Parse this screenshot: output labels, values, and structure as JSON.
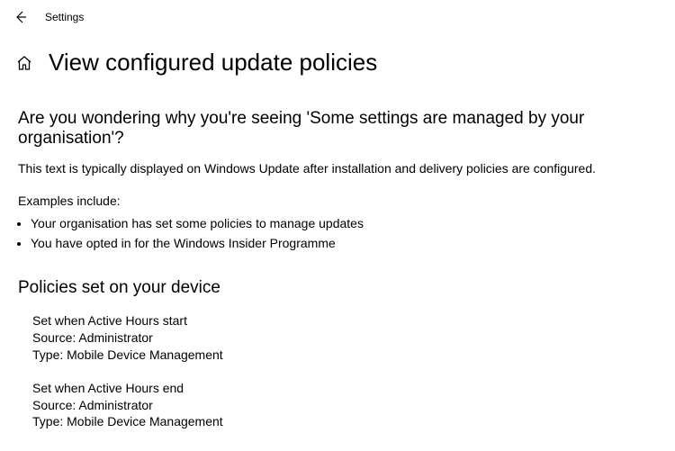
{
  "header": {
    "title": "Settings"
  },
  "page": {
    "title": "View configured update policies"
  },
  "main": {
    "subheading": "Are you wondering why you're seeing 'Some settings are managed by your organisation'?",
    "description": "This text is typically displayed on Windows Update after installation and delivery policies are configured.",
    "examples_label": "Examples include:",
    "examples": [
      "Your organisation has set some policies to manage updates",
      "You have opted in for the Windows Insider Programme"
    ],
    "policies_heading": "Policies set on your device",
    "policies": [
      {
        "name": "Set when Active Hours start",
        "source_label": "Source:",
        "source": "Administrator",
        "type_label": "Type:",
        "type": "Mobile Device Management"
      },
      {
        "name": "Set when Active Hours end",
        "source_label": "Source:",
        "source": "Administrator",
        "type_label": "Type:",
        "type": "Mobile Device Management"
      }
    ]
  }
}
